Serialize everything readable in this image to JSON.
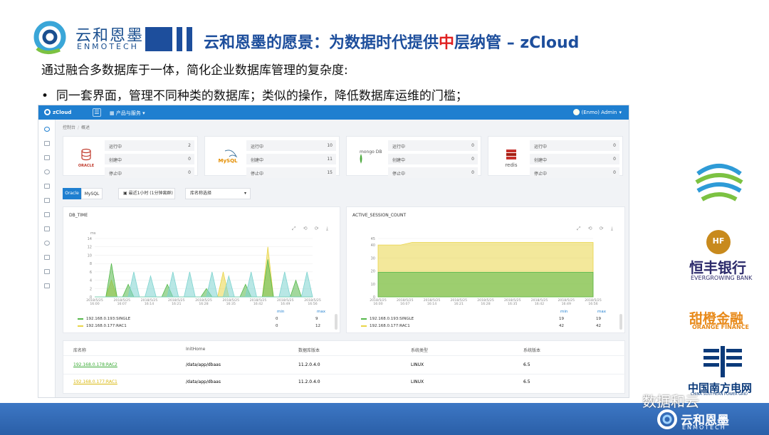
{
  "slide": {
    "logo_cn": "云和恩墨",
    "logo_en": "ENMOTECH",
    "title_part1": "云和恩墨的愿景：为数据时代提供",
    "title_highlight": "中",
    "title_part2": "层纳管 – zCloud",
    "subtitle": "通过融合多数据库于一体，简化企业数据库管理的复杂度:",
    "bullet_mark": "•",
    "bullet": "同一套界面，管理不同种类的数据库；类似的操作，降低数据库运维的门槛；"
  },
  "app": {
    "brand": "zCloud",
    "menu_icon": "☰",
    "products_menu": "产品与服务",
    "user": "(Enmo) Admin",
    "breadcrumb": [
      "控制台",
      "概述"
    ],
    "cards": [
      {
        "db": "Oracle",
        "logo_text": "ORACLE",
        "rows": [
          {
            "label": "运行中",
            "value": "2"
          },
          {
            "label": "创建中",
            "value": "0"
          },
          {
            "label": "停止中",
            "value": "0"
          }
        ]
      },
      {
        "db": "MySQL",
        "logo_text": "MySQL",
        "rows": [
          {
            "label": "运行中",
            "value": "10"
          },
          {
            "label": "创建中",
            "value": "11"
          },
          {
            "label": "停止中",
            "value": "15"
          }
        ]
      },
      {
        "db": "MongoDB",
        "logo_text": "mongo DB",
        "rows": [
          {
            "label": "运行中",
            "value": "0"
          },
          {
            "label": "创建中",
            "value": "0"
          },
          {
            "label": "停止中",
            "value": "0"
          }
        ]
      },
      {
        "db": "Redis",
        "logo_text": "redis",
        "rows": [
          {
            "label": "运行中",
            "value": "0"
          },
          {
            "label": "创建中",
            "value": "0"
          },
          {
            "label": "停止中",
            "value": "0"
          }
        ]
      }
    ],
    "tabs": [
      "Oracle",
      "MySQL"
    ],
    "time_select": "最近1小时 (1分钟离群)",
    "db_select": "库名称选择",
    "chart_tools": "⤢ ⟲ ⟳ ⤓",
    "table": {
      "headers": [
        "库名称",
        "InitHome",
        "数据库版本",
        "系统类型",
        "系统版本"
      ],
      "rows": [
        [
          "192.168.0.178:RAC2",
          "/data/app/dbaas",
          "11.2.0.4.0",
          "LINUX",
          "6.5"
        ],
        [
          "192.168.0.177:RAC1",
          "/data/app/dbaas",
          "11.2.0.4.0",
          "LINUX",
          "6.5"
        ]
      ]
    }
  },
  "chart_data": [
    {
      "type": "area",
      "title": "DB_TIME",
      "ylabel": "ms",
      "ylim": [
        0,
        14
      ],
      "yticks": [
        "0",
        "2",
        "4",
        "6",
        "8",
        "10",
        "12",
        "14"
      ],
      "x_ticks": [
        [
          "2018/5/25",
          "16:00"
        ],
        [
          "2018/5/25",
          "16:07"
        ],
        [
          "2018/5/25",
          "16:14"
        ],
        [
          "2018/5/25",
          "16:21"
        ],
        [
          "2018/5/25",
          "16:28"
        ],
        [
          "2018/5/25",
          "16:35"
        ],
        [
          "2018/5/25",
          "16:42"
        ],
        [
          "2018/5/25",
          "16:49"
        ],
        [
          "2018/5/25",
          "16:56"
        ]
      ],
      "series": [
        {
          "name": "192.168.0.193:SINGLE",
          "color": "#55b84b",
          "values": [
            0,
            0,
            0,
            8,
            0,
            0,
            3,
            0,
            0,
            0,
            0,
            0,
            0,
            3,
            0,
            0,
            0,
            0,
            0,
            0,
            2,
            0,
            0,
            0,
            0,
            0,
            0,
            3,
            0,
            0,
            0,
            9,
            0,
            0,
            0,
            0,
            4,
            0,
            0,
            0
          ]
        },
        {
          "name": "192.168.0.177:RAC1",
          "color": "#e9d548",
          "values": [
            0,
            0,
            0,
            4,
            0,
            0,
            0,
            0,
            0,
            0,
            0,
            0,
            0,
            0,
            0,
            0,
            0,
            0,
            0,
            0,
            0,
            0,
            0,
            6,
            0,
            0,
            0,
            0,
            0,
            0,
            0,
            12,
            0,
            0,
            0,
            0,
            0,
            0,
            0,
            0
          ]
        },
        {
          "name": "",
          "color": "#7dd3cf",
          "values": [
            0,
            0,
            0,
            0,
            0,
            0,
            0,
            6,
            0,
            0,
            5,
            0,
            0,
            0,
            6,
            0,
            0,
            6,
            0,
            0,
            0,
            6,
            0,
            0,
            5,
            0,
            0,
            0,
            6,
            0,
            0,
            0,
            0,
            0,
            6,
            0,
            0,
            0,
            6,
            0
          ]
        }
      ],
      "legend": {
        "headers": [
          "min",
          "max"
        ],
        "rows": [
          [
            "192.168.0.193:SINGLE",
            "0",
            "9"
          ],
          [
            "192.168.0.177:RAC1",
            "0",
            "12"
          ]
        ]
      }
    },
    {
      "type": "area",
      "title": "ACTIVE_SESSION_COUNT",
      "ylim": [
        0,
        45
      ],
      "yticks": [
        "0",
        "10",
        "20",
        "30",
        "40",
        "45"
      ],
      "x_ticks": [
        [
          "2018/5/25",
          "16:00"
        ],
        [
          "2018/5/25",
          "16:07"
        ],
        [
          "2018/5/25",
          "16:14"
        ],
        [
          "2018/5/25",
          "16:21"
        ],
        [
          "2018/5/25",
          "16:28"
        ],
        [
          "2018/5/25",
          "16:35"
        ],
        [
          "2018/5/25",
          "16:42"
        ],
        [
          "2018/5/25",
          "16:49"
        ],
        [
          "2018/5/25",
          "16:56"
        ]
      ],
      "series": [
        {
          "name": "192.168.0.193:SINGLE",
          "color": "#55b84b",
          "values": [
            19,
            19,
            19,
            19,
            19,
            19,
            19,
            19,
            19,
            19,
            19,
            19,
            19,
            19,
            19,
            19,
            19,
            19,
            19,
            19
          ]
        },
        {
          "name": "192.168.0.177:RAC1",
          "color": "#e9d548",
          "values": [
            40,
            40,
            40,
            42,
            42,
            42,
            42,
            42,
            42,
            42,
            42,
            42,
            42,
            42,
            42,
            42,
            42,
            42,
            42,
            42
          ]
        }
      ],
      "legend": {
        "headers": [
          "min",
          "max"
        ],
        "rows": [
          [
            "192.168.0.193:SINGLE",
            "19",
            "19"
          ],
          [
            "192.168.0.177:RAC1",
            "42",
            "42"
          ]
        ]
      }
    }
  ],
  "partners": {
    "hengfeng_badge": "HF",
    "hengfeng_cn": "恒丰银行",
    "hengfeng_en": "EVERGROWING BANK",
    "orange_cn": "甜橙金融",
    "orange_en": "ORANGE FINANCE",
    "grid_cn": "中国南方电网",
    "grid_en": "CHINA SOUTHERN POWER GRID"
  },
  "footer": {
    "wechat": "数据和云",
    "logo_cn": "云和恩墨",
    "logo_en": "ENMOTECH"
  }
}
